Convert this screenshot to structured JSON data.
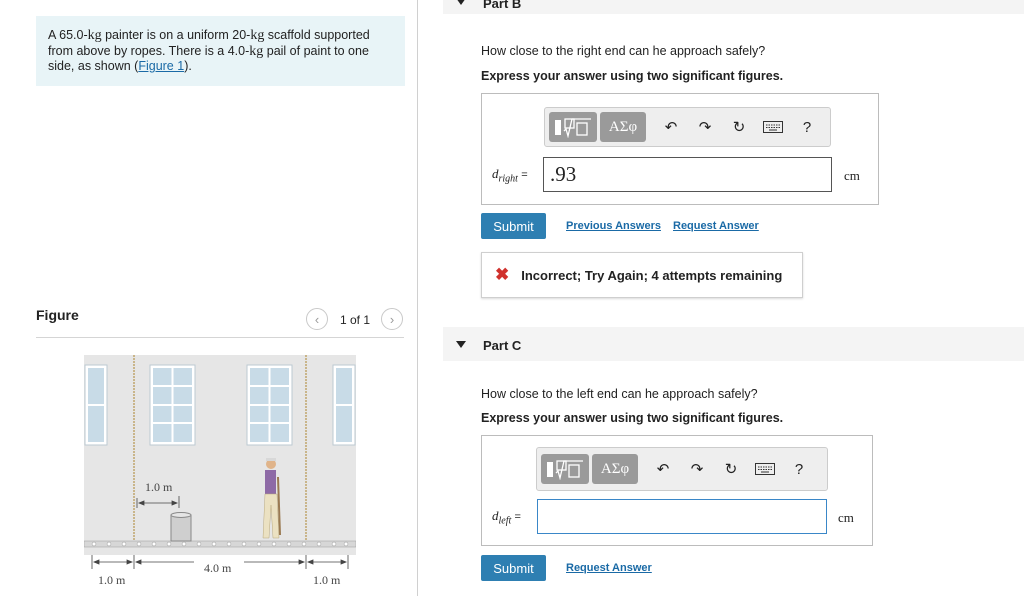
{
  "problem": {
    "t1": "A 65.0-",
    "kg1": "kg",
    "t2": " painter is on a uniform 20-",
    "kg2": "kg",
    "t3": " scaffold supported from above by ropes. There is a 4.0-",
    "kg3": "kg",
    "t4": " pail of paint to one side, as shown (",
    "link": "Figure 1",
    "t5": ")."
  },
  "figure": {
    "title": "Figure",
    "pager": "1 of 1",
    "prev_icon": "chevron-left-icon",
    "next_icon": "chevron-right-icon",
    "dim_pail": "1.0 m",
    "dim_mid": "4.0 m",
    "dim_left": "1.0 m",
    "dim_right": "1.0 m"
  },
  "partB": {
    "label": "Part B",
    "question": "How close to the right end can he approach safely?",
    "instruction": "Express your answer using two significant figures.",
    "var": "d",
    "var_sub": "right",
    "eq": "=",
    "value": ".93",
    "unit": "cm",
    "submit": "Submit",
    "prev_answers": "Previous Answers",
    "request": "Request Answer",
    "feedback_icon": "x-icon",
    "feedback": "Incorrect; Try Again; 4 attempts remaining"
  },
  "partC": {
    "label": "Part C",
    "question": "How close to the left end can he approach safely?",
    "instruction": "Express your answer using two significant figures.",
    "var": "d",
    "var_sub": "left",
    "eq": "=",
    "value": "",
    "unit": "cm",
    "submit": "Submit",
    "request": "Request Answer"
  },
  "toolbar": {
    "greek": "ΑΣφ",
    "help": "?",
    "icons": [
      "templates-icon",
      "greek-symbols-icon",
      "undo-icon",
      "redo-icon",
      "reset-icon",
      "keyboard-icon",
      "help-icon"
    ]
  },
  "colors": {
    "accent": "#2e7fb2",
    "error": "#d0312d",
    "problem_bg": "#e8f4f7"
  }
}
